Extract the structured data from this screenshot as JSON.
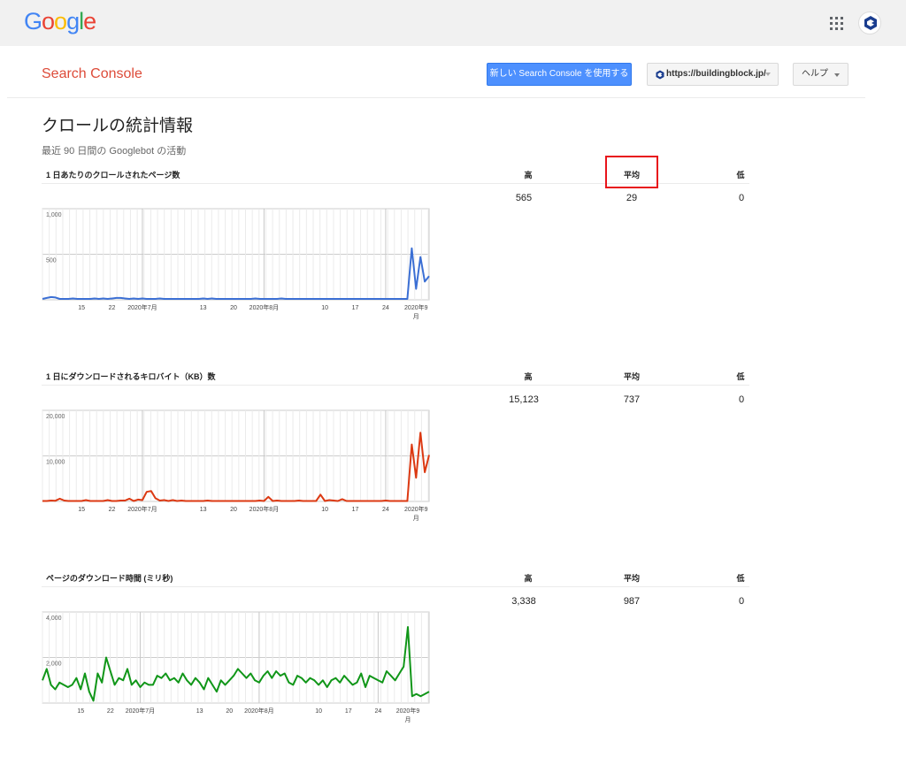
{
  "topbar": {
    "logo_letters": [
      {
        "ch": "G",
        "color": "#4285f4"
      },
      {
        "ch": "o",
        "color": "#ea4335"
      },
      {
        "ch": "o",
        "color": "#fbbc05"
      },
      {
        "ch": "g",
        "color": "#4285f4"
      },
      {
        "ch": "l",
        "color": "#34a853"
      },
      {
        "ch": "e",
        "color": "#ea4335"
      }
    ],
    "apps_icon": "apps-grid-icon",
    "avatar_icon": "account-avatar"
  },
  "header": {
    "app_title": "Search Console",
    "new_console_button": "新しい Search Console を使用する",
    "property_select": "https://buildingblock.jp/",
    "help_button": "ヘルプ"
  },
  "page": {
    "title": "クロールの統計情報",
    "subtitle": "最近 90 日間の Googlebot の活動"
  },
  "columns": {
    "high": "高",
    "avg": "平均",
    "low": "低"
  },
  "sections": [
    {
      "label": "1 日あたりのクロールされたページ数",
      "high": "565",
      "avg": "29",
      "low": "0",
      "color": "#3b6fd4"
    },
    {
      "label": "1 日にダウンロードされるキロバイト（KB）数",
      "high": "15,123",
      "avg": "737",
      "low": "0",
      "color": "#dc3912"
    },
    {
      "label": "ページのダウンロード時間 (ミリ秒)",
      "high": "3,338",
      "avg": "987",
      "low": "0",
      "color": "#109618"
    }
  ],
  "chart_data": [
    {
      "type": "line",
      "ylim": [
        0,
        1000
      ],
      "y_ticks": [
        "1,000",
        "500"
      ],
      "x_ticks": [
        "15",
        "22",
        "2020年7月",
        "13",
        "20",
        "2020年8月",
        "10",
        "17",
        "24",
        "2020年9月"
      ],
      "color": "#3b6fd4",
      "values": [
        10,
        20,
        30,
        25,
        10,
        10,
        10,
        15,
        10,
        10,
        10,
        10,
        15,
        10,
        15,
        10,
        15,
        20,
        20,
        15,
        10,
        15,
        10,
        15,
        10,
        10,
        10,
        15,
        10,
        10,
        10,
        10,
        10,
        10,
        10,
        10,
        10,
        15,
        10,
        15,
        10,
        10,
        10,
        10,
        10,
        10,
        10,
        10,
        10,
        15,
        10,
        10,
        10,
        10,
        10,
        15,
        10,
        10,
        10,
        10,
        10,
        10,
        10,
        10,
        10,
        10,
        10,
        10,
        10,
        10,
        10,
        10,
        10,
        10,
        10,
        10,
        10,
        10,
        10,
        10,
        10,
        10,
        10,
        10,
        10,
        565,
        120,
        470,
        200,
        260
      ]
    },
    {
      "type": "line",
      "ylim": [
        0,
        20000
      ],
      "y_ticks": [
        "20,000",
        "10,000"
      ],
      "x_ticks": [
        "15",
        "22",
        "2020年7月",
        "13",
        "20",
        "2020年8月",
        "10",
        "17",
        "24",
        "2020年9月"
      ],
      "color": "#dc3912",
      "values": [
        100,
        100,
        200,
        150,
        600,
        200,
        100,
        100,
        100,
        100,
        300,
        100,
        100,
        100,
        100,
        300,
        100,
        100,
        200,
        200,
        600,
        100,
        400,
        300,
        2100,
        2300,
        700,
        200,
        300,
        100,
        300,
        100,
        200,
        100,
        100,
        100,
        100,
        100,
        200,
        100,
        100,
        100,
        100,
        100,
        100,
        100,
        100,
        100,
        100,
        100,
        200,
        100,
        1000,
        100,
        200,
        100,
        100,
        100,
        100,
        200,
        100,
        100,
        100,
        100,
        1500,
        100,
        300,
        200,
        100,
        500,
        100,
        100,
        100,
        100,
        100,
        100,
        100,
        100,
        100,
        200,
        100,
        100,
        100,
        100,
        100,
        12500,
        5200,
        15100,
        6400,
        10200
      ]
    },
    {
      "type": "line",
      "ylim": [
        0,
        4000
      ],
      "y_ticks": [
        "4,000",
        "2,000"
      ],
      "x_ticks": [
        "15",
        "22",
        "2020年7月",
        "13",
        "20",
        "2020年8月",
        "10",
        "17",
        "24",
        "2020年9月"
      ],
      "color": "#109618",
      "values": [
        1000,
        1500,
        800,
        600,
        900,
        800,
        700,
        800,
        1100,
        600,
        1300,
        500,
        100,
        1300,
        900,
        2000,
        1400,
        800,
        1100,
        1000,
        1500,
        800,
        1000,
        700,
        900,
        800,
        800,
        1200,
        1100,
        1300,
        1000,
        1100,
        900,
        1300,
        1000,
        800,
        1100,
        900,
        600,
        1100,
        800,
        500,
        1000,
        800,
        1000,
        1200,
        1500,
        1300,
        1100,
        1300,
        1000,
        900,
        1200,
        1400,
        1100,
        1400,
        1200,
        1300,
        900,
        800,
        1200,
        1100,
        900,
        1100,
        1000,
        800,
        1000,
        700,
        1000,
        1100,
        900,
        1200,
        1000,
        800,
        900,
        1300,
        700,
        1200,
        1100,
        1000,
        900,
        1400,
        1200,
        1000,
        1300,
        1600,
        3338,
        300,
        400,
        300,
        400,
        500
      ]
    }
  ]
}
